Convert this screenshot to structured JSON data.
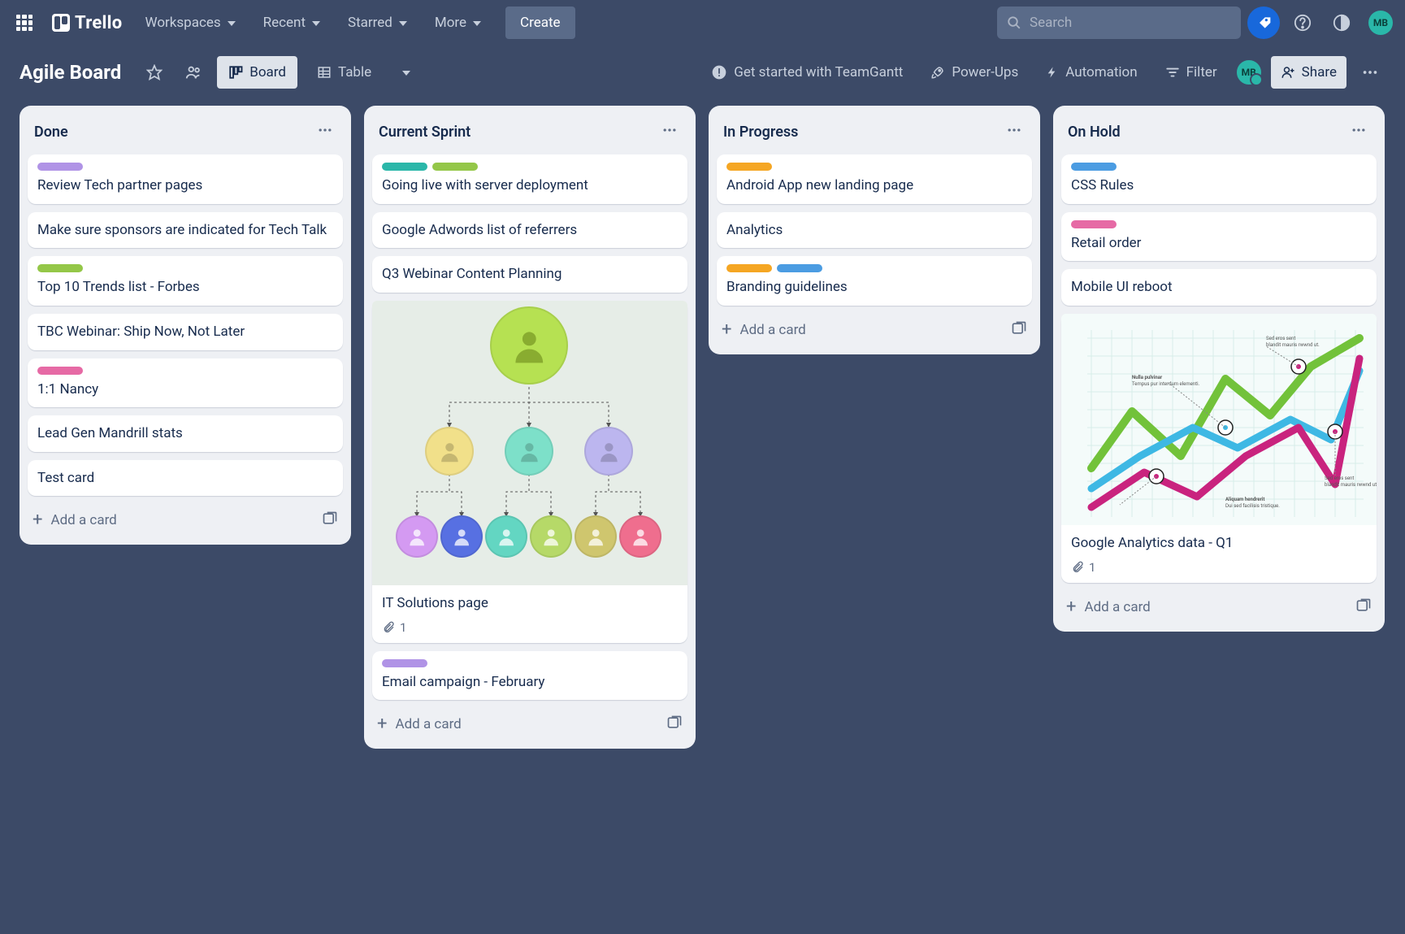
{
  "brand": "Trello",
  "nav": {
    "workspaces": "Workspaces",
    "recent": "Recent",
    "starred": "Starred",
    "more": "More",
    "create": "Create"
  },
  "search": {
    "placeholder": "Search"
  },
  "user": {
    "initials": "MB"
  },
  "board": {
    "title": "Agile Board",
    "views": {
      "board": "Board",
      "table": "Table"
    },
    "getstarted": "Get started with TeamGantt",
    "powerups": "Power-Ups",
    "automation": "Automation",
    "filter": "Filter",
    "share": "Share"
  },
  "lists": [
    {
      "title": "Done",
      "cards": [
        {
          "labels": [
            "purple"
          ],
          "title": "Review Tech partner pages"
        },
        {
          "labels": [],
          "title": "Make sure sponsors are indicated for Tech Talk"
        },
        {
          "labels": [
            "green"
          ],
          "title": "Top 10 Trends list - Forbes"
        },
        {
          "labels": [],
          "title": "TBC Webinar: Ship Now, Not Later"
        },
        {
          "labels": [
            "pink"
          ],
          "title": "1:1 Nancy"
        },
        {
          "labels": [],
          "title": "Lead Gen Mandrill stats"
        },
        {
          "labels": [],
          "title": "Test card"
        }
      ]
    },
    {
      "title": "Current Sprint",
      "cards": [
        {
          "labels": [
            "teal",
            "green"
          ],
          "title": "Going live with server deployment"
        },
        {
          "labels": [],
          "title": "Google Adwords list of referrers"
        },
        {
          "labels": [],
          "title": "Q3 Webinar Content Planning"
        },
        {
          "labels": [],
          "title": "IT Solutions page",
          "cover": "org",
          "attachments": "1"
        },
        {
          "labels": [
            "purple"
          ],
          "title": "Email campaign - February"
        }
      ]
    },
    {
      "title": "In Progress",
      "cards": [
        {
          "labels": [
            "orange"
          ],
          "title": "Android App new landing page"
        },
        {
          "labels": [],
          "title": "Analytics"
        },
        {
          "labels": [
            "orange",
            "blue"
          ],
          "title": "Branding guidelines"
        }
      ]
    },
    {
      "title": "On Hold",
      "cards": [
        {
          "labels": [
            "blue"
          ],
          "title": "CSS Rules"
        },
        {
          "labels": [
            "pink"
          ],
          "title": "Retail order"
        },
        {
          "labels": [],
          "title": "Mobile UI reboot"
        },
        {
          "labels": [],
          "title": "Google Analytics data - Q1",
          "cover": "chart",
          "attachments": "1"
        }
      ]
    }
  ],
  "addcard": "Add a card"
}
